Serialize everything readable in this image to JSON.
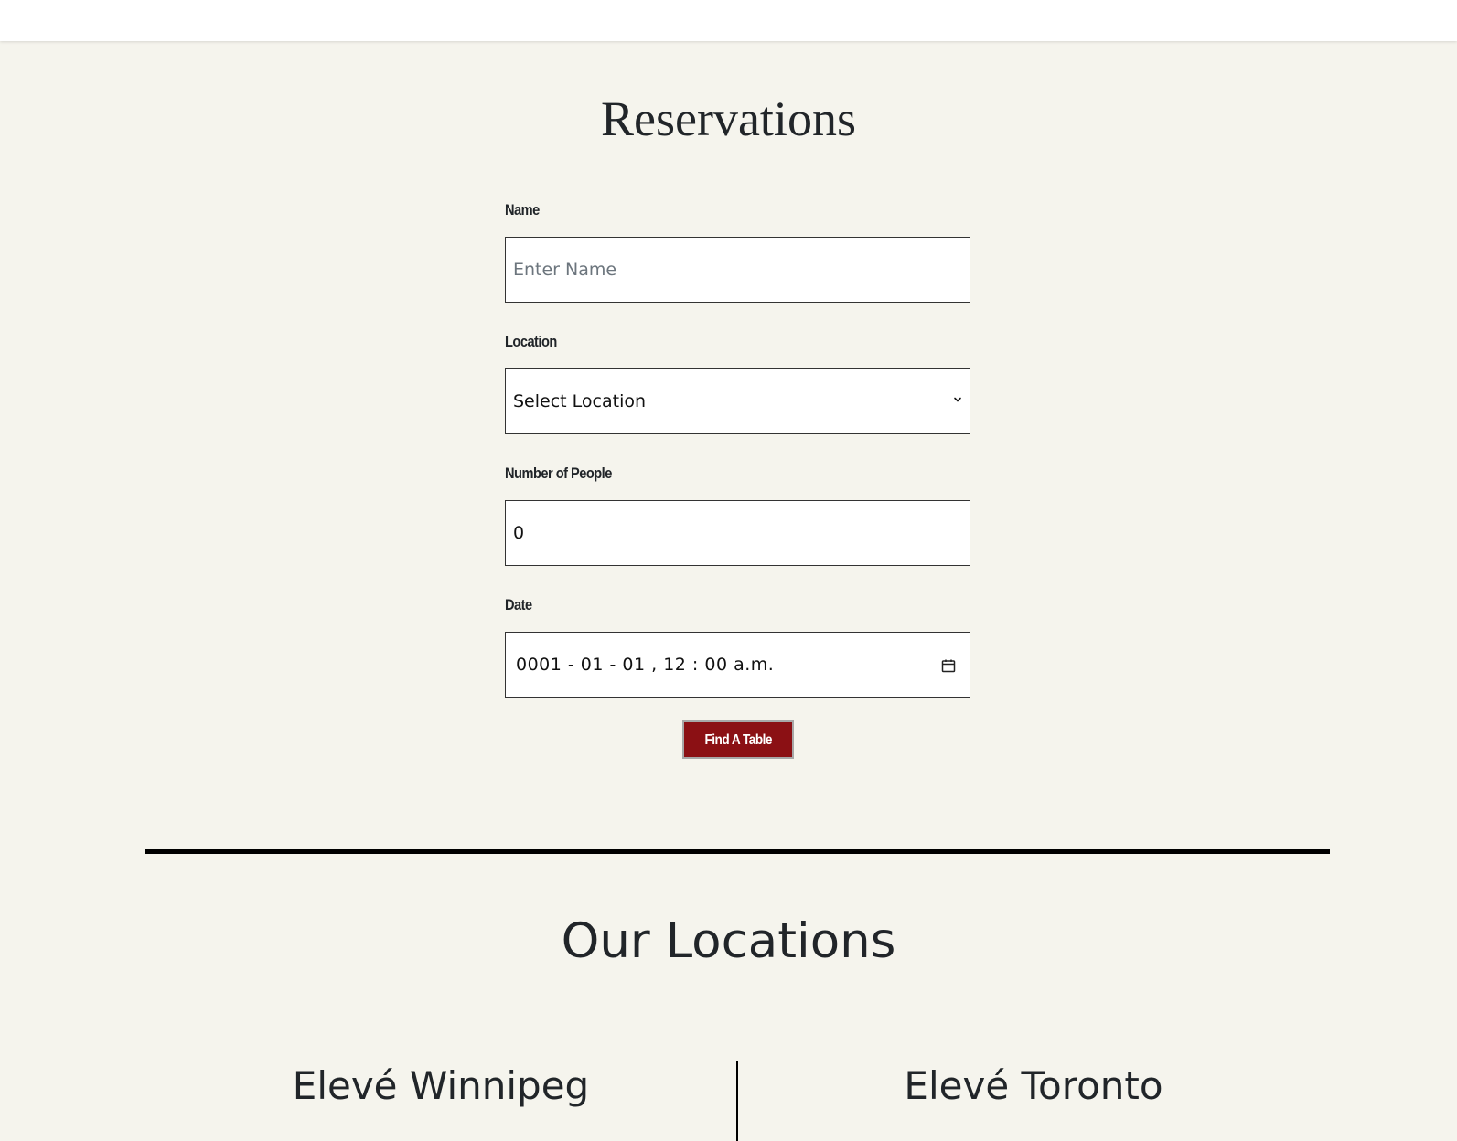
{
  "reservations": {
    "title": "Reservations",
    "fields": {
      "name": {
        "label": "Name",
        "placeholder": "Enter Name",
        "value": ""
      },
      "location": {
        "label": "Location",
        "selected": "Select Location"
      },
      "people": {
        "label": "Number of People",
        "value": "0"
      },
      "date": {
        "label": "Date",
        "value": "0001 - 01 - 01 ,  12 : 00   a.m."
      }
    },
    "submit_label": "Find A Table"
  },
  "locations": {
    "title": "Our Locations",
    "items": [
      {
        "name": "Elevé Winnipeg"
      },
      {
        "name": "Elevé Toronto"
      }
    ]
  },
  "colors": {
    "background": "#f5f4ed",
    "button": "#8b1014",
    "text": "#212529"
  },
  "icons": {
    "select_arrow": "chevron-down-icon",
    "date_picker": "calendar-icon"
  }
}
